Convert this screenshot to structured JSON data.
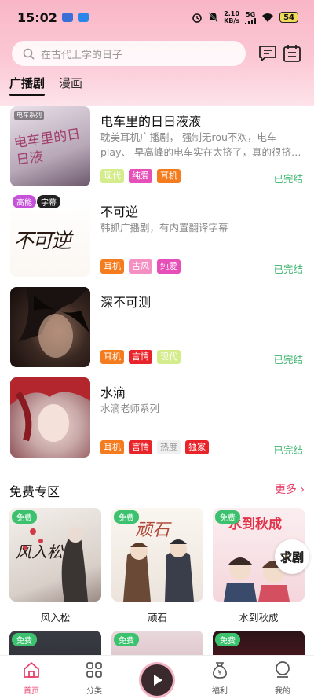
{
  "status_bar": {
    "time": "15:02",
    "net_speed": "2.10",
    "net_unit": "KB/s",
    "signal": "5G",
    "battery": "54"
  },
  "search": {
    "placeholder": "在古代上学的日子"
  },
  "tabs": [
    {
      "label": "广播剧",
      "active": true
    },
    {
      "label": "漫画",
      "active": false
    }
  ],
  "list": [
    {
      "title": "电车里的日日液液",
      "desc": "耽美耳机广播剧， 强制无rou不欢，电车play、 早高峰的电车实在太挤了，真的很挤…",
      "tags": [
        {
          "text": "现代",
          "color": "#c8e87a"
        },
        {
          "text": "纯爱",
          "color": "#e64fb8"
        },
        {
          "text": "耳机",
          "color": "#f47c1e"
        }
      ],
      "status": "已完结",
      "cover_text": "电车里的日日液",
      "cover_label": "电车系列"
    },
    {
      "title": "不可逆",
      "desc": "韩抓广播剧，有内置翻译字幕",
      "tags": [
        {
          "text": "耳机",
          "color": "#f47c1e"
        },
        {
          "text": "古风",
          "color": "#f48fc4"
        },
        {
          "text": "纯爱",
          "color": "#e64fb8"
        }
      ],
      "status": "已完结",
      "badges": [
        {
          "text": "高能",
          "color": "#c552d8"
        },
        {
          "text": "字幕",
          "color": "#222"
        }
      ],
      "cover_text": "不可逆"
    },
    {
      "title": "深不可测",
      "desc": "",
      "tags": [
        {
          "text": "耳机",
          "color": "#f47c1e"
        },
        {
          "text": "言情",
          "color": "#e8242a"
        },
        {
          "text": "现代",
          "color": "#c8e87a"
        }
      ],
      "status": "已完结"
    },
    {
      "title": "水滴",
      "desc": "水滴老师系列",
      "tags": [
        {
          "text": "耳机",
          "color": "#f47c1e"
        },
        {
          "text": "言情",
          "color": "#e8242a"
        },
        {
          "text": "热度",
          "color": "#f0f0f0"
        },
        {
          "text": "独家",
          "color": "#e8242a"
        }
      ],
      "status": "已完结"
    }
  ],
  "free_section": {
    "title": "免费专区",
    "more": "更多",
    "badge": "免费",
    "items": [
      {
        "name": "风入松",
        "cover_text": "风入松"
      },
      {
        "name": "顽石",
        "cover_text": "顽石"
      },
      {
        "name": "水到秋成",
        "cover_text": "水到秋成"
      }
    ],
    "float_label": "求剧"
  },
  "bottom_nav": [
    {
      "label": "首页",
      "icon": "home-icon",
      "active": true
    },
    {
      "label": "分类",
      "icon": "grid-icon",
      "active": false
    },
    {
      "label": "福利",
      "icon": "moneybag-icon",
      "active": false
    },
    {
      "label": "我的",
      "icon": "profile-icon",
      "active": false
    }
  ]
}
